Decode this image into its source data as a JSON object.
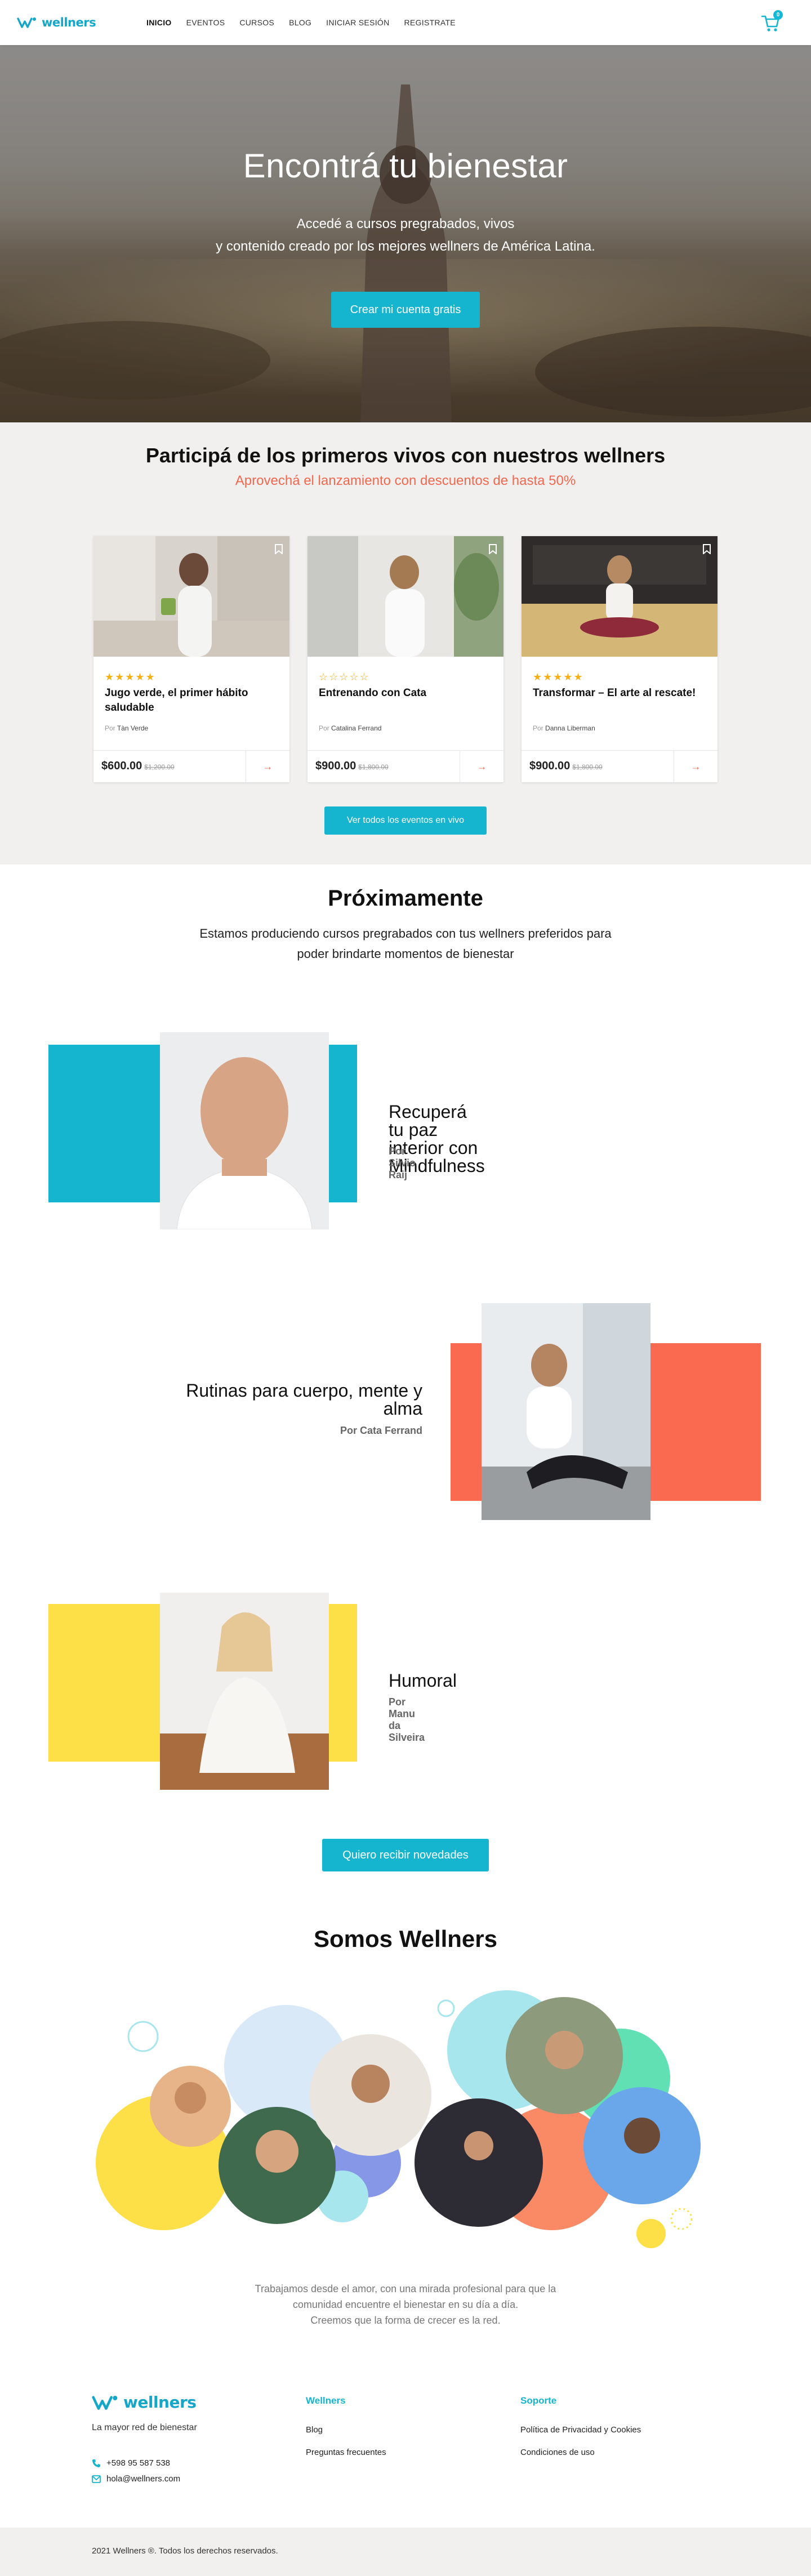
{
  "header": {
    "brand": "wellners",
    "nav": [
      {
        "label": "INICIO",
        "active": true
      },
      {
        "label": "EVENTOS",
        "active": false
      },
      {
        "label": "CURSOS",
        "active": false
      },
      {
        "label": "BLOG",
        "active": false
      },
      {
        "label": "INICIAR SESIÓN",
        "active": false
      },
      {
        "label": "REGISTRATE",
        "active": false
      }
    ],
    "cart_count": "0"
  },
  "hero": {
    "title": "Encontrá tu bienestar",
    "subtitle_line1": "Accedé a cursos pregrabados, vivos",
    "subtitle_line2": "y contenido creado por los mejores wellners de América Latina.",
    "cta": "Crear mi cuenta gratis"
  },
  "live": {
    "title": "Participá de los primeros vivos con nuestros wellners",
    "subtitle": "Aprovechá el lanzamiento con descuentos de hasta 50%",
    "cards": [
      {
        "rating": 5,
        "stars": "★★★★★",
        "title": "Jugo verde, el primer hábito saludable",
        "by_prefix": "Por",
        "author": "Tàn Verde",
        "price": "$600.00",
        "old_price": "$1,200.00"
      },
      {
        "rating": 0,
        "stars": "☆☆☆☆☆",
        "title": "Entrenando con Cata",
        "by_prefix": "Por",
        "author": "Catalina Ferrand",
        "price": "$900.00",
        "old_price": "$1,800.00"
      },
      {
        "rating": 5,
        "stars": "★★★★★",
        "title": "Transformar – El arte al rescate!",
        "by_prefix": "Por",
        "author": "Danna Liberman",
        "price": "$900.00",
        "old_price": "$1,800.00"
      }
    ],
    "button": "Ver todos los eventos en vivo"
  },
  "upcoming": {
    "title": "Próximamente",
    "subtitle_line1": "Estamos produciendo cursos pregrabados con tus wellners preferidos para",
    "subtitle_line2": "poder brindarte momentos de bienestar",
    "courses": [
      {
        "title_line1": "Recuperá tu paz interior con",
        "title_line2": "Mindfulness",
        "by": "Por Silvio Raij",
        "color": "#16b5cf"
      },
      {
        "title_line1": "Rutinas para cuerpo, mente y",
        "title_line2": "alma",
        "by": "Por Cata Ferrand",
        "color": "#fa6a50"
      },
      {
        "title_line1": "Humoral",
        "title_line2": "",
        "by": "Por Manu da Silveira",
        "color": "#fde048"
      }
    ],
    "button": "Quiero recibir novedades"
  },
  "about": {
    "title": "Somos Wellners",
    "text_line1": "Trabajamos desde el amor, con una mirada profesional para que la",
    "text_line2": "comunidad encuentre el bienestar en su día a día.",
    "text_line3": "Creemos que la forma de crecer es la red."
  },
  "footer": {
    "brand": "wellners",
    "tagline": "La mayor red de bienestar",
    "phone": "+598 95 587 538",
    "email": "hola@wellners.com",
    "col1_title": "Wellners",
    "col1_links": [
      "Blog",
      "Preguntas frecuentes"
    ],
    "col2_title": "Soporte",
    "col2_links": [
      "Política de Privacidad y Cookies",
      "Condiciones de uso"
    ],
    "copyright": "2021 Wellners ®. Todos los derechos reservados."
  },
  "colors": {
    "accent": "#16b5cf",
    "coral": "#fa6a50",
    "yellow": "#fde048",
    "star": "#f5b013"
  }
}
